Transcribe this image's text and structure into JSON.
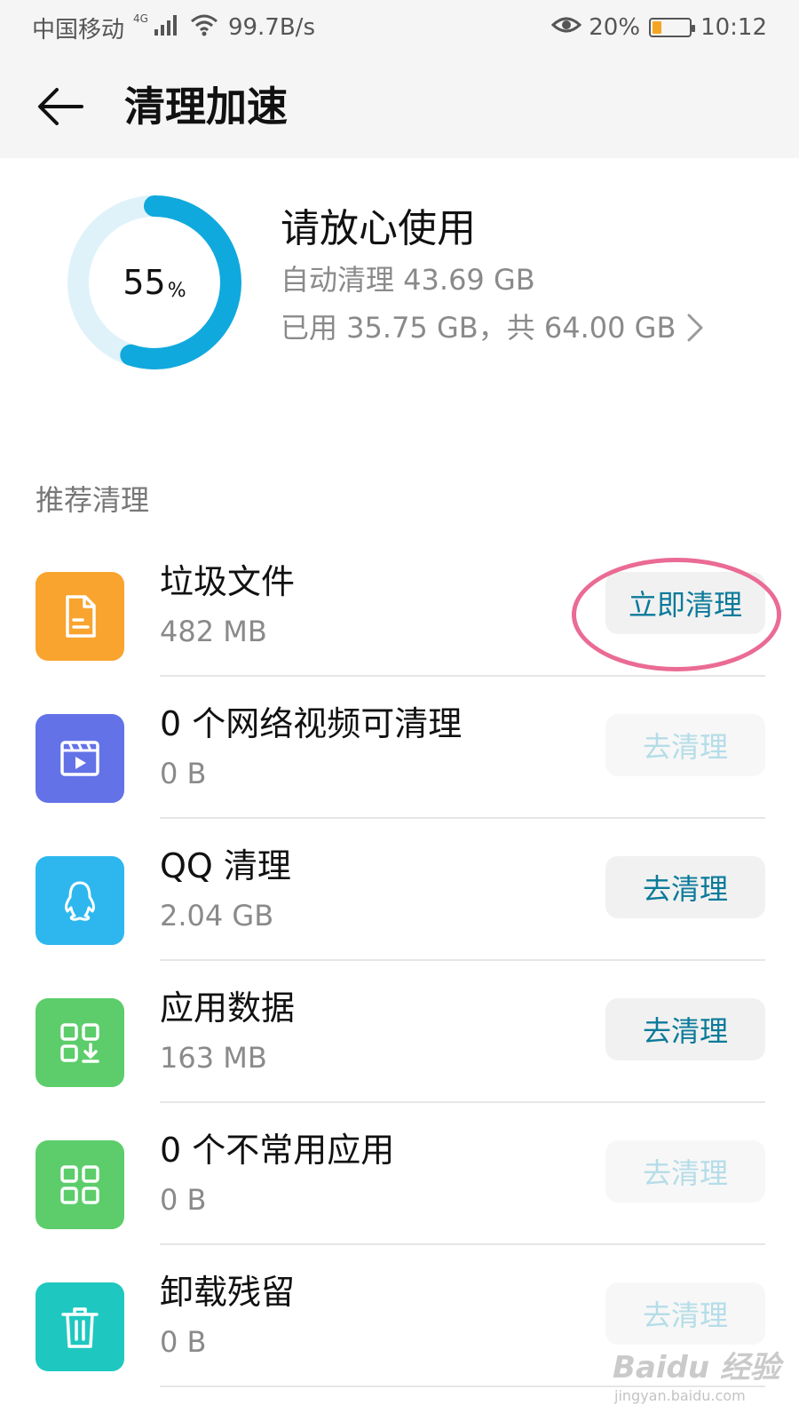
{
  "status_bar": {
    "carrier": "中国移动",
    "network_type": "4G",
    "speed": "99.7B/s",
    "battery_percent": "20%",
    "time": "10:12"
  },
  "app_bar": {
    "title": "清理加速"
  },
  "storage_summary": {
    "used_percent_value": "55",
    "percent_sign": "%",
    "used_fraction": 0.55,
    "status_title": "请放心使用",
    "auto_clean_text": "自动清理 43.69 GB",
    "usage_text": "已用 35.75 GB，共 64.00 GB"
  },
  "recommended": {
    "heading": "推荐清理",
    "items": [
      {
        "title": "垃圾文件",
        "size": "482 MB",
        "button": "立即清理",
        "enabled": true,
        "color": "#f8a42f",
        "icon": "document-icon"
      },
      {
        "title": "0 个网络视频可清理",
        "size": "0 B",
        "button": "去清理",
        "enabled": false,
        "color": "#6472e8",
        "icon": "video-icon"
      },
      {
        "title": "QQ 清理",
        "size": "2.04 GB",
        "button": "去清理",
        "enabled": true,
        "color": "#2db7ee",
        "icon": "qq-penguin-icon"
      },
      {
        "title": "应用数据",
        "size": "163 MB",
        "button": "去清理",
        "enabled": true,
        "color": "#5ccd6a",
        "icon": "app-data-icon"
      },
      {
        "title": "0 个不常用应用",
        "size": "0 B",
        "button": "去清理",
        "enabled": false,
        "color": "#5ccd6a",
        "icon": "apps-grid-icon"
      },
      {
        "title": "卸载残留",
        "size": "0 B",
        "button": "去清理",
        "enabled": false,
        "color": "#1ec8c0",
        "icon": "trash-icon"
      }
    ]
  },
  "colors": {
    "accent": "#0b7a9a",
    "ring_progress": "#10a9dd",
    "ring_track": "#dff2fa",
    "highlight": "#ea6b94"
  }
}
